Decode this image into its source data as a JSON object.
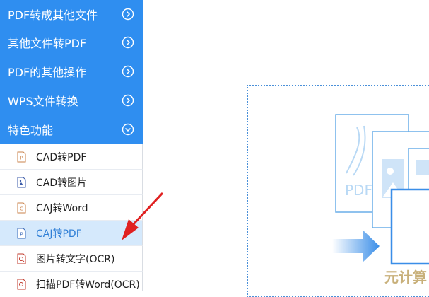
{
  "sidebar": {
    "categories": [
      {
        "label": "PDF转成其他文件",
        "expanded": false
      },
      {
        "label": "其他文件转PDF",
        "expanded": false
      },
      {
        "label": "PDF的其他操作",
        "expanded": false
      },
      {
        "label": "WPS文件转换",
        "expanded": false
      },
      {
        "label": "特色功能",
        "expanded": true
      }
    ],
    "items": [
      {
        "label": "CAD转PDF",
        "icon": "pdf-file-icon"
      },
      {
        "label": "CAD转图片",
        "icon": "image-file-icon"
      },
      {
        "label": "CAJ转Word",
        "icon": "caj-file-icon"
      },
      {
        "label": "CAJ转PDF",
        "icon": "pdf-file-icon",
        "active": true
      },
      {
        "label": "图片转文字(OCR)",
        "icon": "ocr-search-icon"
      },
      {
        "label": "扫描PDF转Word(OCR)",
        "icon": "scan-file-icon"
      }
    ]
  },
  "illustration": {
    "doc_label": "PDF"
  },
  "watermark": "元计算",
  "colors": {
    "accent": "#2f8ef0",
    "active_bg": "#d5e9fc",
    "annotation_arrow": "#e02020"
  }
}
